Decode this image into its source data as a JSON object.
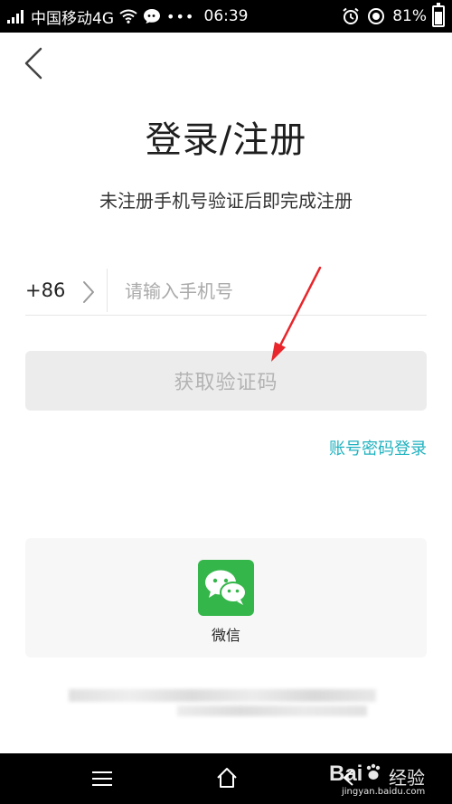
{
  "status_bar": {
    "carrier": "中国移动4G",
    "more": "•••",
    "time": "06:39",
    "battery": "81%",
    "battery_level": 0.81
  },
  "page": {
    "title": "登录/注册",
    "subtitle": "未注册手机号验证后即完成注册"
  },
  "phone": {
    "country_code": "+86",
    "placeholder": "请输入手机号",
    "value": ""
  },
  "buttons": {
    "get_code": "获取验证码",
    "password_login": "账号密码登录"
  },
  "third_party": {
    "wechat_label": "微信"
  },
  "watermark": {
    "brand": "Bai",
    "product": "经验",
    "domain": "jingyan.baidu.com"
  },
  "colors": {
    "accent_link": "#1fb2bf",
    "wechat_green": "#35b64a",
    "arrow_red": "#e8262b"
  },
  "icons": {
    "back": "chevron-left-icon",
    "country_picker": "chevron-right-icon",
    "wechat": "wechat-icon"
  }
}
